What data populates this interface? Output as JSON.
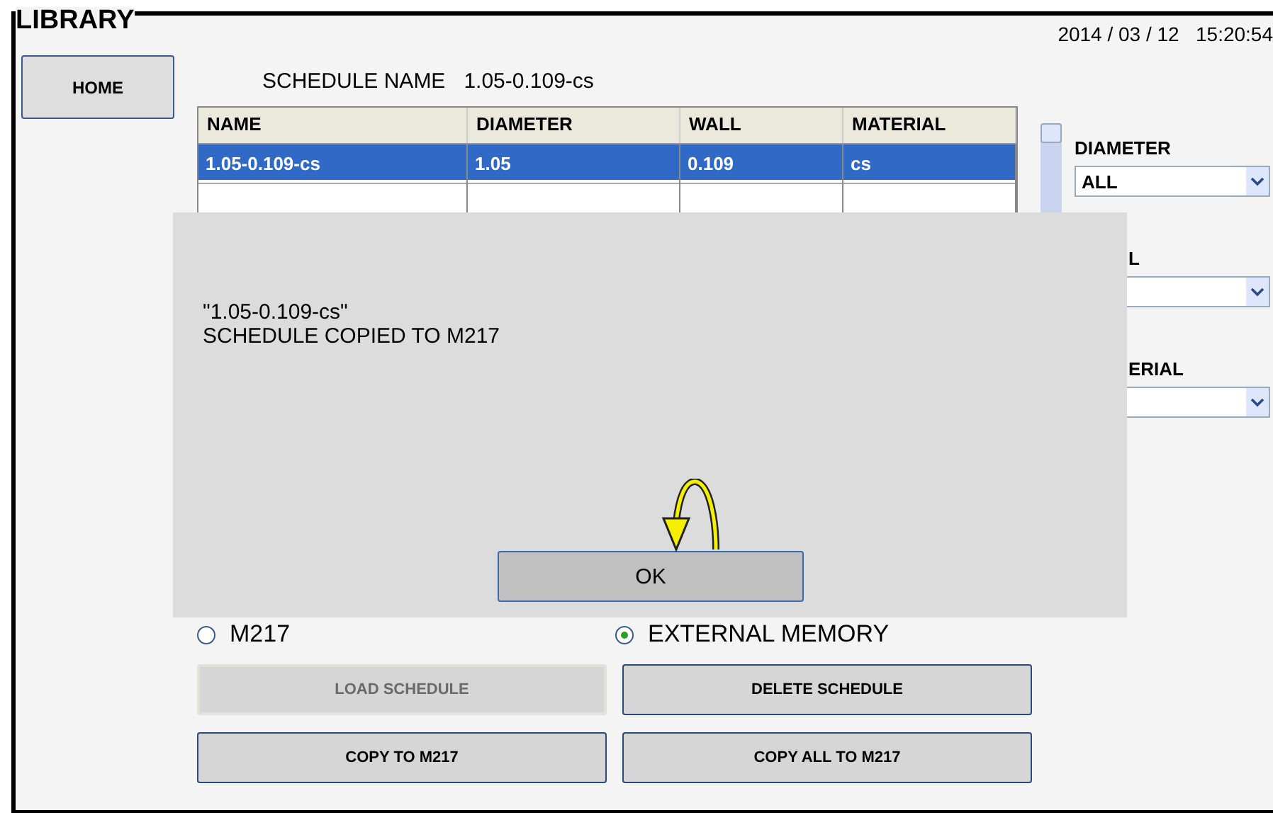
{
  "title": "LIBRARY",
  "datetime": "2014 / 03 / 12   15:20:54",
  "home_button": "HOME",
  "schedule_name": {
    "label": "SCHEDULE NAME",
    "value": "1.05-0.109-cs"
  },
  "table": {
    "columns": [
      "NAME",
      "DIAMETER",
      "WALL",
      "MATERIAL"
    ],
    "rows": [
      {
        "cells": [
          "1.05-0.109-cs",
          "1.05",
          "0.109",
          "cs"
        ],
        "selected": true
      }
    ]
  },
  "filters": [
    {
      "kind": "full",
      "label": "DIAMETER",
      "value": "ALL"
    },
    {
      "kind": "covered",
      "label": "L"
    },
    {
      "kind": "covered",
      "label": "ERIAL"
    }
  ],
  "storage": [
    {
      "label": "M217",
      "selected": false
    },
    {
      "label": "EXTERNAL MEMORY",
      "selected": true
    }
  ],
  "buttons": [
    {
      "label": "LOAD SCHEDULE",
      "disabled": true
    },
    {
      "label": "DELETE SCHEDULE",
      "disabled": false
    },
    {
      "label": "COPY TO M217",
      "disabled": false
    },
    {
      "label": "COPY ALL TO M217",
      "disabled": false
    }
  ],
  "dialog": {
    "lines": [
      "\"1.05-0.109-cs\"",
      "SCHEDULE COPIED TO M217"
    ],
    "button": "OK"
  }
}
